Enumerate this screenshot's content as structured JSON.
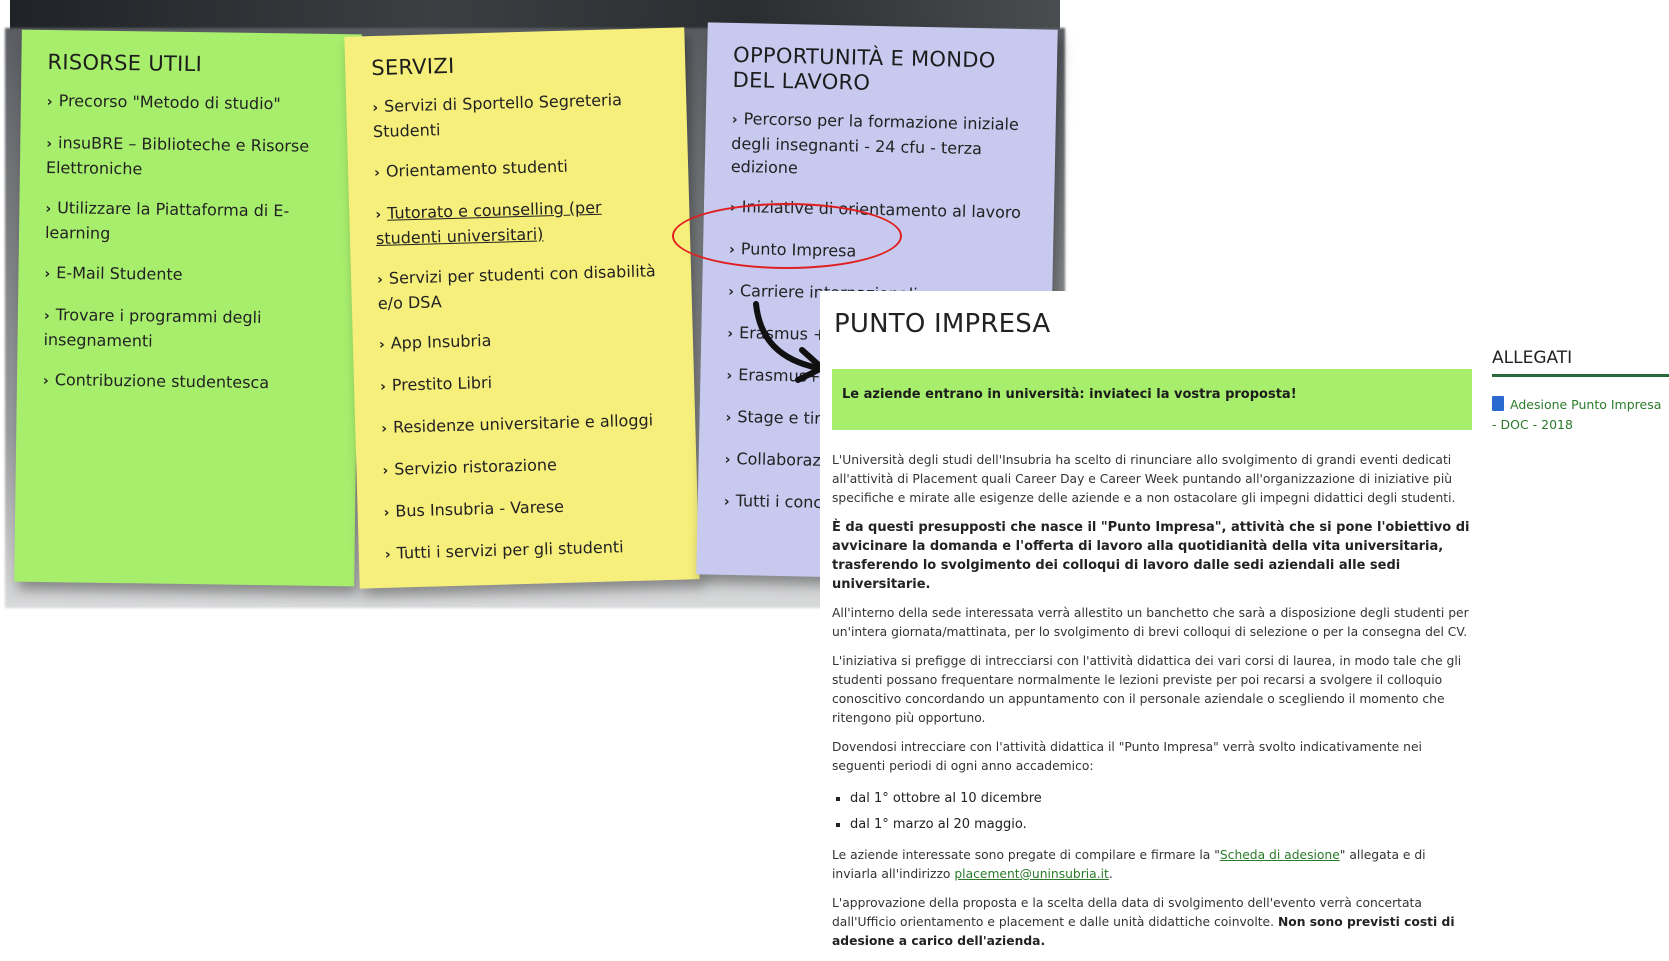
{
  "colors": {
    "risorse_note": "#a8ee6d",
    "servizi_note": "#f7ef7b",
    "lavoro_note": "#c7c9ee",
    "banner": "#a8ee6d",
    "link": "#2a7a2a",
    "highlight_ellipse": "#e02020"
  },
  "notes": {
    "risorse": {
      "title": "RISORSE UTILI",
      "items": [
        "Precorso \"Metodo di studio\"",
        "insuBRE – Biblioteche e Risorse Elettroniche",
        "Utilizzare la Piattaforma di E-learning",
        "E-Mail Studente",
        "Trovare i programmi degli insegnamenti",
        "Contribuzione studentesca"
      ]
    },
    "servizi": {
      "title": "SERVIZI",
      "items": [
        "Servizi di Sportello Segreteria Studenti",
        "Orientamento studenti",
        "Tutorato e counselling (per studenti universitari)",
        "Servizi per studenti con disabilità e/o DSA",
        "App Insubria",
        "Prestito Libri",
        "Residenze universitarie e alloggi",
        "Servizio ristorazione",
        "Bus Insubria - Varese",
        "Tutti i servizi per gli studenti"
      ]
    },
    "lavoro": {
      "title": "OPPORTUNITÀ E MONDO DEL LAVORO",
      "items": [
        "Percorso per la formazione iniziale degli insegnanti - 24 cfu - terza edizione",
        "Iniziative di orientamento al lavoro",
        "Punto Impresa",
        "Carriere internazionali",
        "Erasmus + S",
        "Erasmus+ T",
        "Stage e tiroci",
        "Collaborazion",
        "Tutti i concors studenti..."
      ]
    }
  },
  "chevron": "›",
  "page": {
    "title": "PUNTO IMPRESA",
    "banner": "Le aziende entrano in università: inviateci la vostra proposta!",
    "p1": "L'Università degli studi dell'Insubria ha scelto di rinunciare allo svolgimento di grandi eventi dedicati all'attività di Placement quali Career Day e Career Week puntando all'organizzazione di iniziative più specifiche e mirate alle esigenze delle aziende e a non ostacolare gli impegni didattici degli studenti.",
    "p2": "È da questi presupposti che nasce il \"Punto Impresa\", attività che si pone l'obiettivo di avvicinare la domanda e l'offerta di lavoro alla quotidianità della vita universitaria, trasferendo lo svolgimento dei colloqui di lavoro dalle sedi aziendali alle sedi universitarie.",
    "p3": "All'interno della sede interessata verrà allestito un banchetto che sarà a disposizione degli studenti per un'intera giornata/mattinata, per lo svolgimento di brevi colloqui di selezione o per la consegna del CV.",
    "p4": "L'iniziativa si prefigge di intrecciarsi con l'attività didattica dei vari corsi di laurea, in modo tale che gli studenti possano frequentare normalmente le lezioni previste per poi recarsi a svolgere il colloquio conoscitivo concordando un appuntamento con il personale aziendale o scegliendo il momento che ritengono più opportuno.",
    "p5": "Dovendosi intrecciare con l'attività didattica il \"Punto Impresa\" verrà svolto indicativamente nei seguenti periodi di ogni anno accademico:",
    "periods": [
      "dal 1° ottobre al 10 dicembre",
      "dal 1° marzo al 20 maggio."
    ],
    "p6_before": "Le aziende interessate sono pregate di compilare e firmare la \"",
    "p6_link": "Scheda di adesione",
    "p6_middle": "\" allegata e di inviarla all'indirizzo ",
    "p6_email": "placement@uninsubria.it",
    "p6_after": ".",
    "p7_normal": "L'approvazione della proposta e la scelta della data di svolgimento dell'evento verrà concertata dall'Ufficio orientamento e placement e dalle unità didattiche coinvolte. ",
    "p7_bold": "Non sono previsti costi di adesione a carico dell'azienda."
  },
  "allegati": {
    "title": "ALLEGATI",
    "link": "Adesione Punto Impresa - DOC - 2018"
  }
}
